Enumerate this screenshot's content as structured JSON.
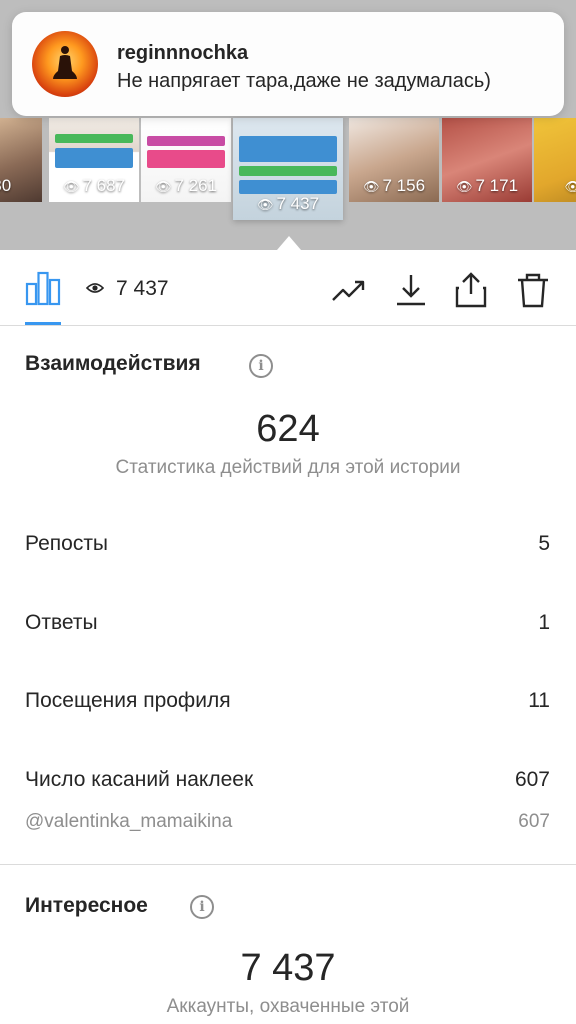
{
  "notification": {
    "username": "reginnnochka",
    "message": "Не напрягает тара,даже не задумалась)"
  },
  "stories": [
    {
      "views": "830"
    },
    {
      "views": "7 687",
      "tag": "@valentinka_mamaikina"
    },
    {
      "views": "7 261",
      "tag": "@valentinka_mamaikina"
    },
    {
      "views": "7 437",
      "tag": "@valentinka_mamaikina"
    },
    {
      "views": "7 156"
    },
    {
      "views": "7 171"
    },
    {
      "views": "7"
    }
  ],
  "toolbar": {
    "views_count": "7 437",
    "icons": [
      "bar-chart-icon",
      "eye-icon",
      "trend-icon",
      "download-icon",
      "share-icon",
      "trash-icon"
    ]
  },
  "interactions": {
    "title": "Взаимодействия",
    "total": "624",
    "caption": "Статистика действий для этой истории",
    "rows": [
      {
        "label": "Репосты",
        "value": "5"
      },
      {
        "label": "Ответы",
        "value": "1"
      },
      {
        "label": "Посещения профиля",
        "value": "11"
      },
      {
        "label": "Число касаний наклеек",
        "value": "607"
      }
    ],
    "sticker_row": {
      "label": "@valentinka_mamaikina",
      "value": "607"
    }
  },
  "discovery": {
    "title": "Интересное",
    "total": "7 437",
    "caption": "Аккаунты, охваченные этой"
  },
  "colors": {
    "accent": "#3897f0",
    "text": "#262626",
    "muted": "#8e8e8e",
    "divider": "#dbdbdb"
  }
}
